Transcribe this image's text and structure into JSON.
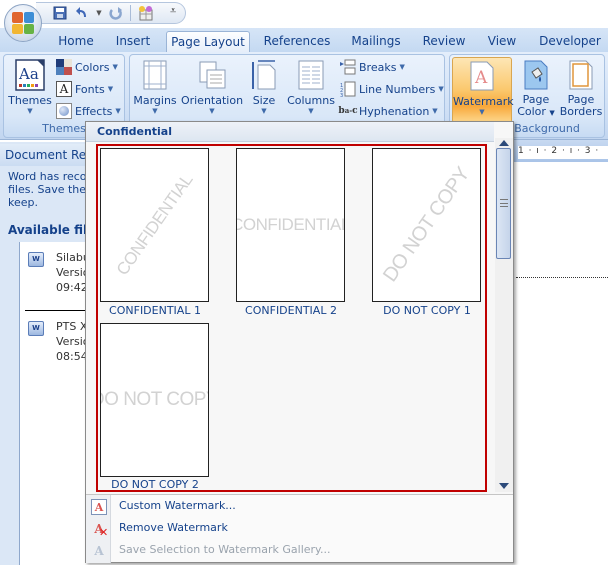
{
  "app": {
    "office_button": "office-button",
    "quick_access": [
      {
        "name": "save",
        "glyph": "💾"
      },
      {
        "name": "undo",
        "glyph": "↶"
      },
      {
        "name": "undo-dropdown",
        "glyph": "▾"
      },
      {
        "name": "redo",
        "glyph": "↻"
      },
      {
        "name": "extra-tool",
        "glyph": "▦"
      }
    ],
    "customize_qat": "⩡"
  },
  "tabs": [
    {
      "label": "Home",
      "active": false
    },
    {
      "label": "Insert",
      "active": false
    },
    {
      "label": "Page Layout",
      "active": true
    },
    {
      "label": "References",
      "active": false
    },
    {
      "label": "Mailings",
      "active": false
    },
    {
      "label": "Review",
      "active": false
    },
    {
      "label": "View",
      "active": false
    },
    {
      "label": "Developer",
      "active": false
    }
  ],
  "ribbon": {
    "themes_group": {
      "label": "Themes",
      "themes_button": "Themes",
      "colors": "Colors",
      "fonts": "Fonts",
      "effects": "Effects"
    },
    "page_setup_group": {
      "margins": "Margins",
      "orientation": "Orientation",
      "size": "Size",
      "columns": "Columns",
      "breaks": "Breaks",
      "line_numbers": "Line Numbers",
      "hyphenation": "Hyphenation"
    },
    "page_background_group": {
      "label": "Background",
      "watermark": "Watermark",
      "page_color_line1": "Page",
      "page_color_line2": "Color",
      "page_borders_line1": "Page",
      "page_borders_line2": "Borders"
    }
  },
  "recovery_pane": {
    "title": "Document Rec",
    "text_lines": [
      "Word has recov",
      "files.  Save the",
      "keep."
    ],
    "available_files": "Available files",
    "files": [
      {
        "lines": [
          "Silabu",
          "Versio",
          "09:42"
        ]
      },
      {
        "lines": [
          "PTS XI",
          "Versio",
          "08:54"
        ]
      }
    ]
  },
  "ruler": {
    "text": "1 · ı · 2 · ı · 3 ·"
  },
  "watermark_gallery": {
    "section_header": "Confidential",
    "items": [
      {
        "label": "CONFIDENTIAL 1",
        "watermark_text": "CONFIDENTIAL",
        "orientation": "diagonal"
      },
      {
        "label": "CONFIDENTIAL 2",
        "watermark_text": "CONFIDENTIAL",
        "orientation": "horizontal"
      },
      {
        "label": "DO NOT COPY 1",
        "watermark_text": "DO NOT COPY",
        "orientation": "diagonal"
      },
      {
        "label": "DO NOT COPY 2",
        "watermark_text": "DO NOT COPY",
        "orientation": "horizontal"
      }
    ],
    "menu": [
      {
        "label": "Custom Watermark...",
        "enabled": true,
        "icon": "custom-watermark-icon"
      },
      {
        "label": "Remove Watermark",
        "enabled": true,
        "icon": "remove-watermark-icon"
      },
      {
        "label": "Save Selection to Watermark Gallery...",
        "enabled": false,
        "icon": "save-selection-icon"
      }
    ]
  },
  "colors": {
    "accent_text": "#15428b",
    "selection_frame": "#c00000",
    "watermark_button_highlight": "#f8a83a"
  }
}
